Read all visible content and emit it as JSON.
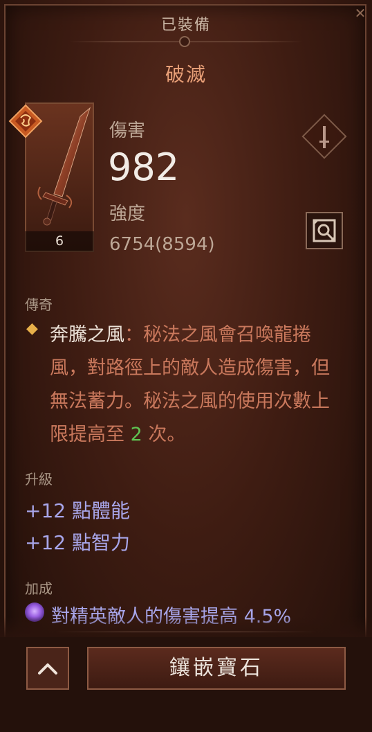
{
  "header": {
    "equipped_label": "已裝備",
    "item_name": "破滅"
  },
  "thumb": {
    "count": "6"
  },
  "stats": {
    "damage_label": "傷害",
    "damage_value": "982",
    "strength_label": "強度",
    "strength_value": "6754(8594)"
  },
  "legendary": {
    "heading": "傳奇",
    "aspect_name": "奔騰之風",
    "separator": "：",
    "text_before": "秘法之風會召喚龍捲風，對路徑上的敵人造成傷害，但無法蓄力。秘法之風的使用次數上限提高至 ",
    "highlight": "2",
    "text_after": " 次。"
  },
  "upgrade": {
    "heading": "升級",
    "lines": [
      "+12 點體能",
      "+12 點智力"
    ]
  },
  "bonus": {
    "heading": "加成",
    "text": "對精英敵人的傷害提高 4.5%"
  },
  "actions": {
    "socket_label": "鑲嵌寶石"
  },
  "icons": {
    "legend_badge": "legendary-badge-icon",
    "weapon_slot": "sword-slot-icon",
    "compare": "compare-icon",
    "collapse": "chevron-up-icon",
    "bonus": "purple-orb-icon"
  },
  "colors": {
    "aspect_text": "#c9785c",
    "highlight": "#5fc452",
    "upgrade_text": "#a8a6ea",
    "item_name": "#e9a078"
  }
}
